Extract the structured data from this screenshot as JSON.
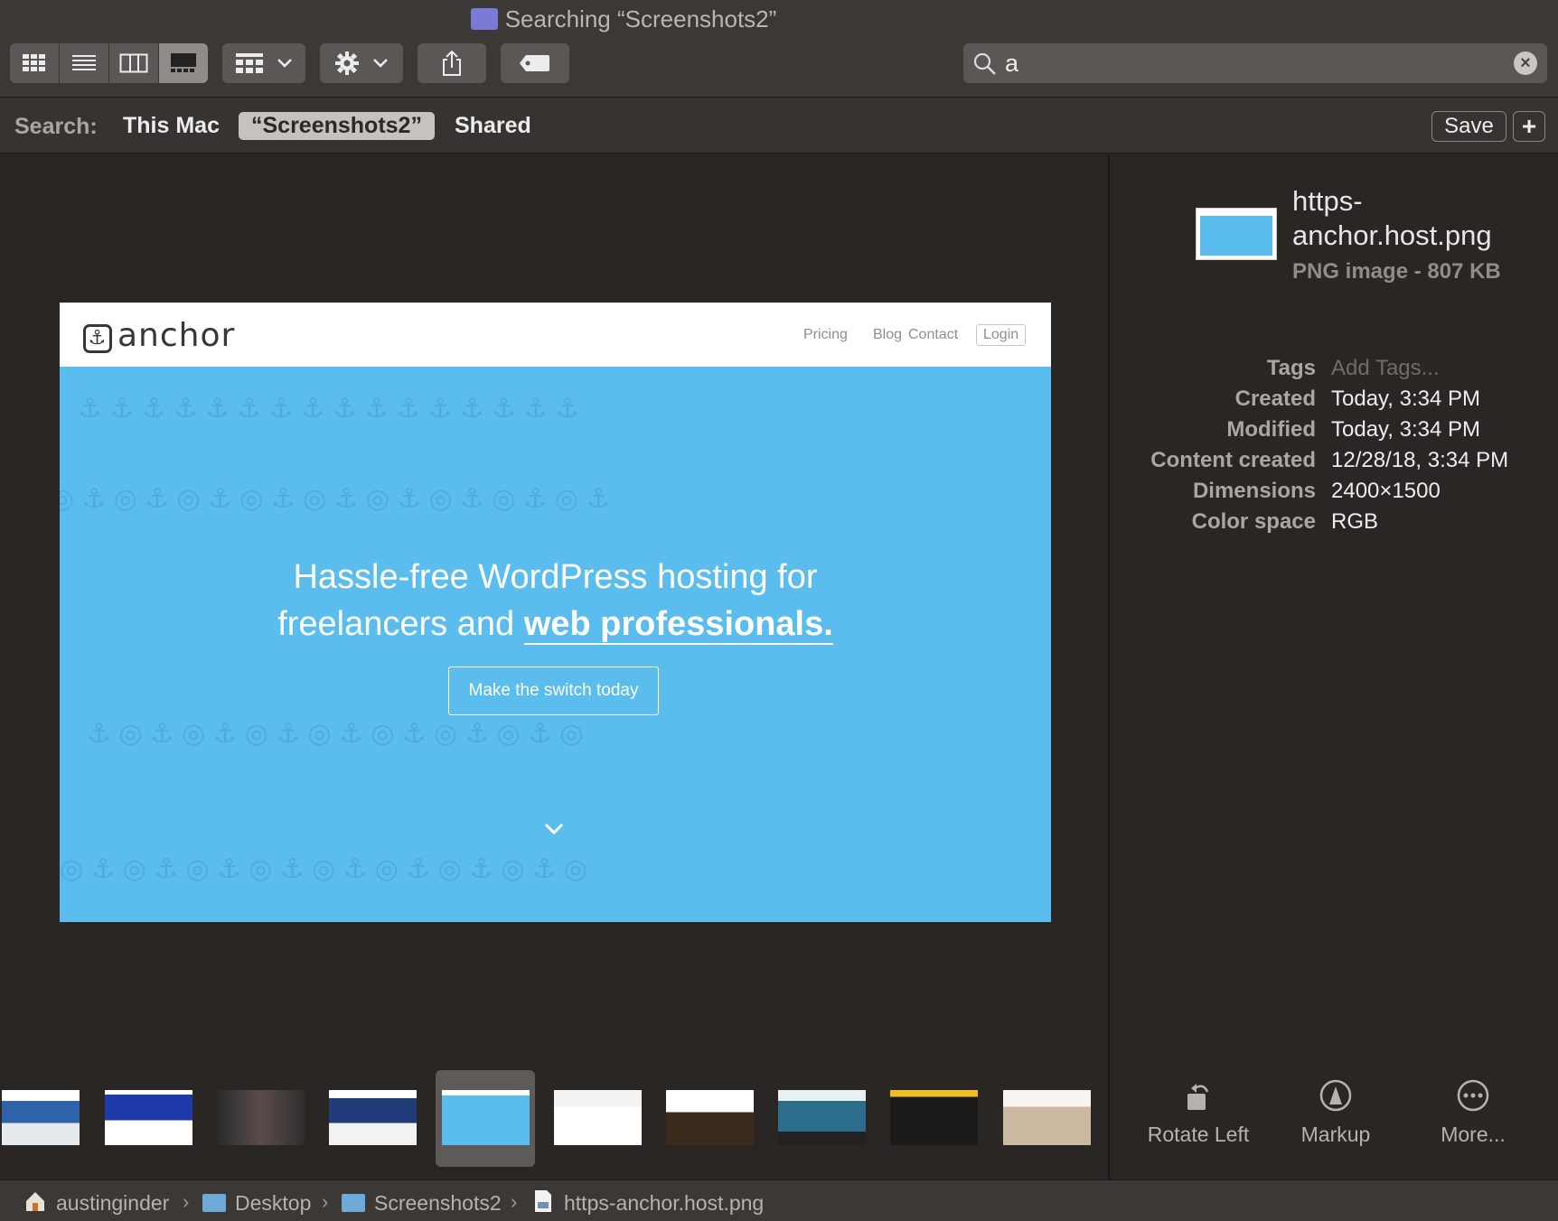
{
  "window": {
    "title": "Searching “Screenshots2”"
  },
  "toolbar": {
    "view_buttons": [
      "icon-view",
      "list-view",
      "column-view",
      "gallery-view"
    ],
    "group_button": "group-by",
    "action_button": "action",
    "share_button": "share",
    "tag_button": "tags"
  },
  "search": {
    "value": "a"
  },
  "scope_bar": {
    "label": "Search:",
    "scopes": [
      "This Mac",
      "“Screenshots2”",
      "Shared"
    ],
    "selected_scope": "“Screenshots2”",
    "save_label": "Save",
    "add_label": "+"
  },
  "preview": {
    "logo": "anchor",
    "nav": [
      "Pricing",
      "Blog",
      "Contact"
    ],
    "login": "Login",
    "headline_1": "Hassle-free WordPress hosting for",
    "headline_2a": "freelancers and ",
    "headline_2b": "web professionals.",
    "cta": "Make the switch today",
    "background_color": "#5bbcee"
  },
  "inspector": {
    "file_name_1": "https-",
    "file_name_2": "anchor.host.png",
    "kind": "PNG image - 807 KB",
    "metadata": [
      {
        "key": "Tags",
        "value": "Add Tags..."
      },
      {
        "key": "Created",
        "value": "Today, 3:34 PM"
      },
      {
        "key": "Modified",
        "value": "Today, 3:34 PM"
      },
      {
        "key": "Content created",
        "value": "12/28/18, 3:34 PM"
      },
      {
        "key": "Dimensions",
        "value": "2400×1500"
      },
      {
        "key": "Color space",
        "value": "RGB"
      }
    ],
    "actions": [
      "Rotate Left",
      "Markup",
      "More..."
    ]
  },
  "path_bar": [
    "austinginder",
    "Desktop",
    "Screenshots2",
    "https-anchor.host.png"
  ],
  "colors": {
    "accent_folder": "#6fa9d8",
    "scope_selected": "#c5c2bf"
  }
}
